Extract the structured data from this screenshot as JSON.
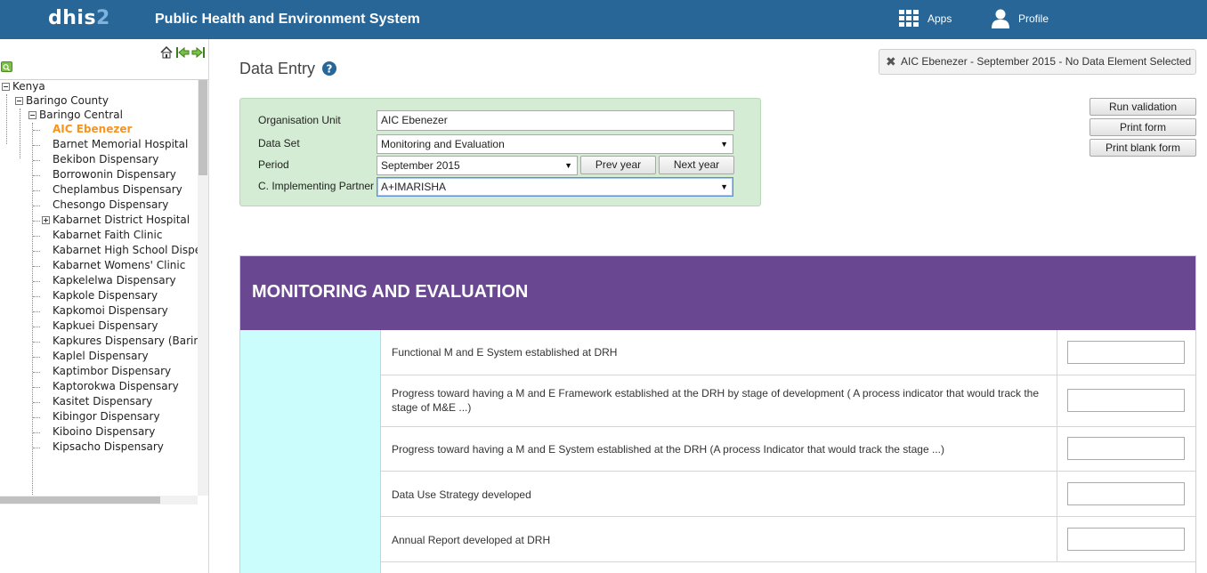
{
  "header": {
    "logo_main": "dhis",
    "logo_num": "2",
    "system_title": "Public Health and Environment System",
    "apps_label": "Apps",
    "profile_label": "Profile"
  },
  "tree": {
    "root": "Kenya",
    "county": "Baringo County",
    "subcounty": "Baringo Central",
    "facilities": [
      "AIC Ebenezer",
      "Barnet Memorial Hospital",
      "Bekibon Dispensary",
      "Borrowonin Dispensary",
      "Cheplambus Dispensary",
      "Chesongo Dispensary",
      "Kabarnet District Hospital",
      "Kabarnet Faith Clinic",
      "Kabarnet High School Dispens",
      "Kabarnet Womens' Clinic",
      "Kapkelelwa Dispensary",
      "Kapkole Dispensary",
      "Kapkomoi Dispensary",
      "Kapkuei Dispensary",
      "Kapkures Dispensary (Baringo",
      "Kaplel Dispensary",
      "Kaptimbor Dispensary",
      "Kaptorokwa Dispensary",
      "Kasitet Dispensary",
      "Kibingor Dispensary",
      "Kiboino Dispensary",
      "Kipsacho Dispensary"
    ],
    "selected": "AIC Ebenezer",
    "expandable": "Kabarnet District Hospital"
  },
  "page": {
    "title": "Data Entry",
    "status_message": "AIC Ebenezer - September 2015 - No Data Element Selected"
  },
  "selection": {
    "org_unit_label": "Organisation Unit",
    "org_unit_value": "AIC Ebenezer",
    "dataset_label": "Data Set",
    "dataset_value": "Monitoring and Evaluation",
    "period_label": "Period",
    "period_value": "September 2015",
    "prev_year": "Prev year",
    "next_year": "Next year",
    "partner_label": "C. Implementing Partner",
    "partner_value": "A+IMARISHA"
  },
  "actions": {
    "run_validation": "Run validation",
    "print_form": "Print form",
    "print_blank_form": "Print blank form"
  },
  "form": {
    "section_title": "MONITORING AND EVALUATION",
    "rows": [
      "Functional M and E System established at DRH",
      "Progress toward having a M and E Framework established at the DRH by stage of development ( A process indicator that would track the stage of M&E ...)",
      "Progress toward having a M and E System established at the DRH (A process Indicator that would track the stage ...)",
      "Data Use Strategy developed",
      "Annual Report developed at DRH"
    ]
  },
  "colors": {
    "header_bg": "#276696",
    "selection_bg": "#d3ecd3",
    "section_bg": "#6a4791",
    "cyan_col": "#ccfdfd",
    "selected_node": "#f7941d"
  }
}
